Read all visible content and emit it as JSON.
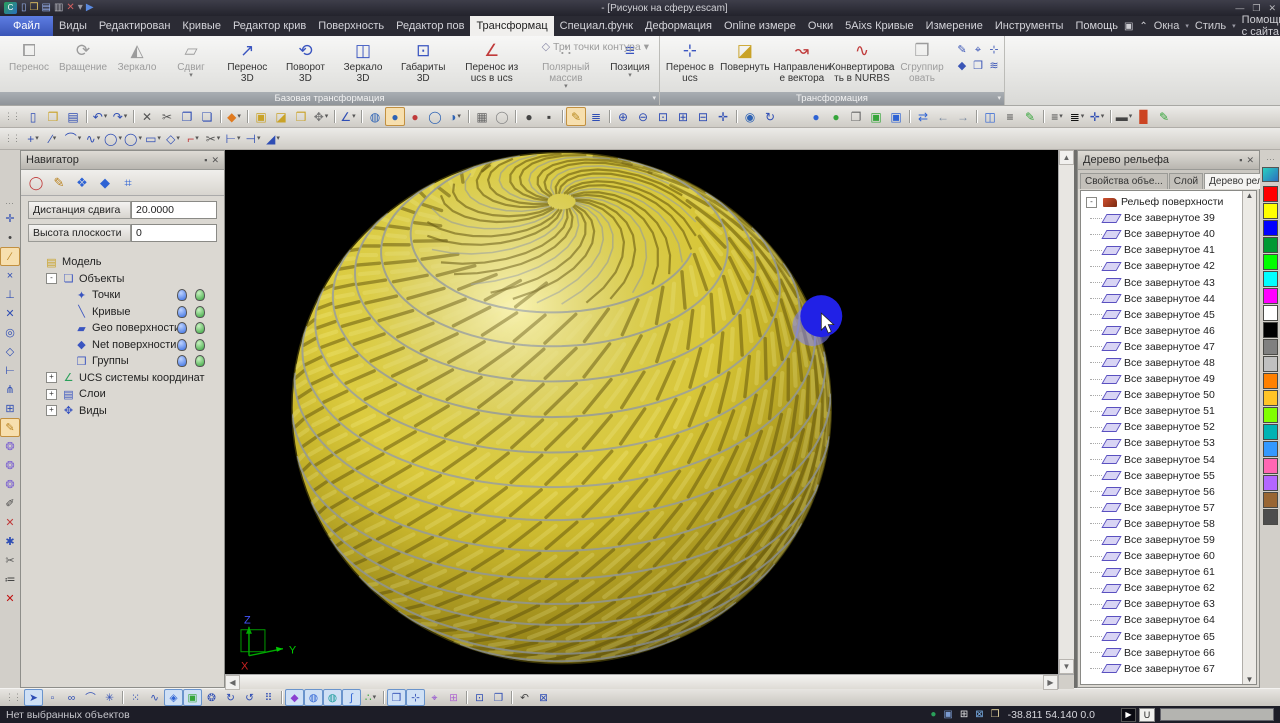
{
  "titlebar": {
    "title": "- [Рисунок на сферу.escam]",
    "logo_glyph": "C",
    "quick_icons": [
      {
        "name": "new-file-icon",
        "g": "▯",
        "c": "#9ab4f0"
      },
      {
        "name": "open-file-icon",
        "g": "❒",
        "c": "#e0c060"
      },
      {
        "name": "save-file-icon",
        "g": "▤",
        "c": "#9ab4f0"
      },
      {
        "name": "print-icon",
        "g": "▥",
        "c": "#b8b8c0"
      },
      {
        "name": "delete-icon",
        "g": "✕",
        "c": "#d06060"
      },
      {
        "name": "caret-icon",
        "g": "▾",
        "c": "#9a9aa4"
      },
      {
        "name": "play-icon",
        "g": "▶",
        "c": "#5a8ae0"
      }
    ],
    "controls": {
      "minimize": "—",
      "restore": "❐",
      "close": "✕"
    }
  },
  "menubar": {
    "items": [
      {
        "label": "Файл",
        "style": "file"
      },
      {
        "label": "Виды"
      },
      {
        "label": "Редактирован"
      },
      {
        "label": "Кривые"
      },
      {
        "label": "Редактор крив"
      },
      {
        "label": "Поверхность"
      },
      {
        "label": "Редактор пов"
      },
      {
        "label": "Трансформац",
        "style": "active"
      },
      {
        "label": "Специал.функ"
      },
      {
        "label": "Деформация"
      },
      {
        "label": "Online измере"
      },
      {
        "label": "Очки"
      },
      {
        "label": "5Aixs Кривые"
      },
      {
        "label": "Измерение"
      },
      {
        "label": "Инструменты"
      },
      {
        "label": "Помощь"
      }
    ],
    "right": {
      "window_label": "Окна",
      "style_label": "Стиль",
      "help_label": "Помощь с сайта"
    },
    "right_controls": {
      "minimize": "—",
      "restore": "❐",
      "close": "✕"
    }
  },
  "ribbon": {
    "group1": {
      "title": "Базовая трансформация",
      "buttons": [
        {
          "name": "move-button",
          "label": "Перенос",
          "g": "⧠",
          "c": "#9c9c9c",
          "dis": true
        },
        {
          "name": "rotate-button",
          "label": "Вращение",
          "g": "⟳",
          "c": "#9c9c9c",
          "dis": true
        },
        {
          "name": "mirror-button",
          "label": "Зеркало",
          "g": "◭",
          "c": "#9c9c9c",
          "dis": true
        },
        {
          "name": "shear-button",
          "label": "Сдвиг",
          "g": "▱",
          "c": "#9c9c9c",
          "dis": true,
          "dd": true
        },
        {
          "name": "move-3d-button",
          "label": "Перенос 3D",
          "g": "↗",
          "c": "#3a55c0"
        },
        {
          "name": "rotate-3d-button",
          "label": "Поворот 3D",
          "g": "⟲",
          "c": "#3a55c0"
        },
        {
          "name": "mirror-3d-button",
          "label": "Зеркало 3D",
          "g": "◫",
          "c": "#3a55c0"
        },
        {
          "name": "extents-3d-button",
          "label": "Габариты 3D",
          "g": "⊡",
          "c": "#3a55c0"
        },
        {
          "name": "move-ucs-to-ucs-button",
          "label": "Перенос из ucs в ucs",
          "g": "∠",
          "c": "#c03a3a"
        },
        {
          "name": "polar-array-button",
          "label": "Полярный массив",
          "g": "∴",
          "c": "#9c9c9c",
          "dis": true,
          "dd": true
        },
        {
          "name": "position-button",
          "label": "Позиция",
          "g": "≡",
          "c": "#3a55c0",
          "dd": true
        }
      ],
      "extra": {
        "label": "Три точки контура",
        "glyph": "◇"
      }
    },
    "group2": {
      "title": "Трансформация",
      "buttons": [
        {
          "name": "move-in-ucs-button",
          "label": "Перенос в ucs",
          "g": "⊹",
          "c": "#3a55c0"
        },
        {
          "name": "turn-button",
          "label": "Повернуть",
          "g": "◪",
          "c": "#c9a227"
        },
        {
          "name": "vector-direction-button",
          "label": "Направлени е вектора",
          "g": "↝",
          "c": "#c03a3a"
        },
        {
          "name": "convert-nurbs-button",
          "label": "Конвертирова ть в NURBS",
          "g": "∿",
          "c": "#c03a3a"
        },
        {
          "name": "group-button",
          "label": "Сгруппир овать",
          "g": "❒",
          "c": "#9c9c9c",
          "dis": true
        }
      ],
      "mini": [
        {
          "name": "mini-edit-icon",
          "g": "✎"
        },
        {
          "name": "mini-axes-icon",
          "g": "⌖"
        },
        {
          "name": "mini-pin-icon",
          "g": "⊹"
        },
        {
          "name": "mini-diamond-icon",
          "g": "◆"
        },
        {
          "name": "mini-copy-icon",
          "g": "❐"
        },
        {
          "name": "mini-layers-icon",
          "g": "≋"
        }
      ]
    }
  },
  "toolbar1": {
    "icons": [
      {
        "n": "new-file",
        "g": "▯",
        "c": "#2e4db4"
      },
      {
        "n": "open-file",
        "g": "❒",
        "c": "#c9a227"
      },
      {
        "n": "save-file",
        "g": "▤",
        "c": "#2e4db4"
      },
      "|",
      {
        "n": "undo",
        "g": "↶",
        "c": "#2e4db4",
        "dd": 1
      },
      {
        "n": "redo",
        "g": "↷",
        "c": "#2e4db4",
        "dd": 1
      },
      "|",
      {
        "n": "delete",
        "g": "✕",
        "c": "#555555"
      },
      {
        "n": "cut",
        "g": "✂",
        "c": "#555555"
      },
      {
        "n": "copy",
        "g": "❐",
        "c": "#2e4db4"
      },
      {
        "n": "paste",
        "g": "❏",
        "c": "#2e4db4"
      },
      "|",
      {
        "n": "view-iso",
        "g": "◆",
        "c": "#e07a1f",
        "dd": 1
      },
      "|",
      {
        "n": "view-cube-front",
        "g": "▣",
        "c": "#c9a227"
      },
      {
        "n": "view-cube-side",
        "g": "◪",
        "c": "#c9a227"
      },
      {
        "n": "view-cube-top",
        "g": "❒",
        "c": "#c9a227"
      },
      {
        "n": "view-more",
        "g": "✥",
        "c": "#777777",
        "dd": 1
      },
      "|",
      {
        "n": "view-ucs",
        "g": "∠",
        "c": "#2e4db4",
        "dd": 1
      },
      "|",
      {
        "n": "render-wireframe",
        "g": "◍",
        "c": "#2e63b4"
      },
      {
        "n": "render-shaded",
        "g": "●",
        "c": "#2e63b4",
        "sel": 1
      },
      {
        "n": "render-material",
        "g": "●",
        "c": "#c03a3a"
      },
      {
        "n": "render-ghost",
        "g": "◯",
        "c": "#2e63b4"
      },
      {
        "n": "render-half",
        "g": "◑",
        "c": "#2e63b4",
        "dd": 1
      },
      "|",
      {
        "n": "mesh-view",
        "g": "▦",
        "c": "#666666"
      },
      {
        "n": "sphere-plain",
        "g": "◯",
        "c": "#888888"
      },
      "|",
      {
        "n": "shade-dark",
        "g": "●",
        "c": "#444444"
      },
      {
        "n": "cube-dark",
        "g": "▪",
        "c": "#444444"
      },
      "|",
      {
        "n": "sketch-mode",
        "g": "✎",
        "c": "#b98a1f",
        "sel": 1
      },
      {
        "n": "plane-list",
        "g": "≣",
        "c": "#2e4db4"
      },
      "|",
      {
        "n": "zoom-in",
        "g": "⊕",
        "c": "#2e4db4"
      },
      {
        "n": "zoom-out",
        "g": "⊖",
        "c": "#2e4db4"
      },
      {
        "n": "zoom-window",
        "g": "⊡",
        "c": "#2e4db4"
      },
      {
        "n": "zoom-fit",
        "g": "⊞",
        "c": "#2e4db4"
      },
      {
        "n": "zoom-prev",
        "g": "⊟",
        "c": "#2e4db4"
      },
      {
        "n": "pan",
        "g": "✛",
        "c": "#2e4db4"
      },
      "|",
      {
        "n": "orbit",
        "g": "◉",
        "c": "#2e63b4"
      },
      {
        "n": "spin",
        "g": "↻",
        "c": "#2e4db4"
      },
      "gap",
      {
        "n": "lamp-blue",
        "g": "●",
        "c": "#2e63d4"
      },
      {
        "n": "lamp-green",
        "g": "●",
        "c": "#35a53a"
      },
      {
        "n": "copy-props",
        "g": "❐",
        "c": "#666666"
      },
      {
        "n": "box-green",
        "g": "▣",
        "c": "#35a53a"
      },
      {
        "n": "box-blue",
        "g": "▣",
        "c": "#2e63d4"
      },
      "|",
      {
        "n": "swap",
        "g": "⇄",
        "c": "#2e63d4"
      },
      {
        "n": "arrow-back",
        "g": "←",
        "c": "#7a8aa0"
      },
      {
        "n": "arrow-forward",
        "g": "→",
        "c": "#7a8aa0"
      },
      "|",
      {
        "n": "cube-edit",
        "g": "◫",
        "c": "#2e63d4"
      },
      {
        "n": "hatch-lines",
        "g": "≡",
        "c": "#444444"
      },
      {
        "n": "picker-pen",
        "g": "✎",
        "c": "#35a53a"
      },
      "|",
      {
        "n": "line-style",
        "g": "≡",
        "c": "#444444",
        "dd": 1
      },
      {
        "n": "line-weight",
        "g": "≣",
        "c": "#111111",
        "dd": 1
      },
      {
        "n": "point-style",
        "g": "✛",
        "c": "#2e4db4",
        "dd": 1
      },
      "|",
      {
        "n": "color-bar",
        "g": "▬",
        "c": "#444444",
        "dd": 1
      },
      {
        "n": "color-swatch",
        "g": "▉",
        "c": "#cc4422"
      },
      {
        "n": "color-picker",
        "g": "✎",
        "c": "#35a53a"
      }
    ]
  },
  "toolbar2": {
    "icons": [
      {
        "n": "draw-point",
        "g": "+",
        "c": "#2e4db4",
        "dd": 1
      },
      {
        "n": "draw-line",
        "g": "∕",
        "c": "#2e4db4",
        "dd": 1
      },
      {
        "n": "draw-arc",
        "g": "⌒",
        "c": "#2e4db4",
        "dd": 1
      },
      {
        "n": "draw-spline",
        "g": "∿",
        "c": "#2e4db4",
        "dd": 1
      },
      {
        "n": "draw-circle",
        "g": "◯",
        "c": "#2e4db4",
        "dd": 1
      },
      {
        "n": "draw-ellipse",
        "g": "◯",
        "c": "#2e4db4",
        "dd": 1
      },
      {
        "n": "draw-rect",
        "g": "▭",
        "c": "#2e4db4",
        "dd": 1
      },
      {
        "n": "draw-polygon",
        "g": "◇",
        "c": "#2e4db4",
        "dd": 1
      },
      {
        "n": "draw-fillet",
        "g": "⌐",
        "c": "#c03a3a",
        "dd": 1
      },
      {
        "n": "trim",
        "g": "✂",
        "c": "#555555",
        "dd": 1
      },
      {
        "n": "extend",
        "g": "⊢",
        "c": "#2e4db4",
        "dd": 1
      },
      {
        "n": "offset",
        "g": "⊣",
        "c": "#2e4db4",
        "dd": 1
      },
      {
        "n": "chamfer",
        "g": "◢",
        "c": "#2e4db4",
        "dd": 1
      }
    ]
  },
  "lefttools": {
    "icons": [
      {
        "n": "snap-node",
        "g": "✛",
        "c": "#2e4db4"
      },
      {
        "n": "snap-point",
        "g": "•",
        "c": "#444444"
      },
      {
        "n": "line-tool",
        "g": "∕",
        "c": "#b9821f",
        "sel": 1
      },
      {
        "n": "snap-intersect",
        "g": "×",
        "c": "#2e4db4"
      },
      {
        "n": "snap-perp",
        "g": "⊥",
        "c": "#2e4db4"
      },
      {
        "n": "snap-cross",
        "g": "✕",
        "c": "#2e4db4"
      },
      {
        "n": "snap-center",
        "g": "◎",
        "c": "#2e4db4"
      },
      {
        "n": "snap-quadrant",
        "g": "◇",
        "c": "#2e4db4"
      },
      {
        "n": "snap-tangent",
        "g": "⊢",
        "c": "#2e4db4"
      },
      {
        "n": "snap-angle",
        "g": "⋔",
        "c": "#2e4db4"
      },
      {
        "n": "snap-grid",
        "g": "⊞",
        "c": "#2e4db4"
      },
      {
        "n": "sketch-pencil",
        "g": "✎",
        "c": "#b9821f",
        "sel": 1
      },
      {
        "n": "surface-tool-1",
        "g": "❂",
        "c": "#7a5fd0"
      },
      {
        "n": "surface-tool-2",
        "g": "❂",
        "c": "#7a5fd0"
      },
      {
        "n": "surface-tool-3",
        "g": "❂",
        "c": "#7a5fd0"
      },
      {
        "n": "erase-tool",
        "g": "✐",
        "c": "#444444"
      },
      {
        "n": "delete-red",
        "g": "✕",
        "c": "#c03a3a"
      },
      {
        "n": "util-tool",
        "g": "✱",
        "c": "#2e4db4"
      },
      {
        "n": "cut-tool",
        "g": "✂",
        "c": "#555555"
      },
      {
        "n": "list-tool",
        "g": "≔",
        "c": "#444444"
      },
      {
        "n": "close-red",
        "g": "✕",
        "c": "#c01010"
      }
    ]
  },
  "navigator": {
    "title": "Навигатор",
    "tools": [
      {
        "n": "nav-profile",
        "g": "◯",
        "c": "#c03a3a"
      },
      {
        "n": "nav-sketch",
        "g": "✎",
        "c": "#b9821f"
      },
      {
        "n": "nav-mesh",
        "g": "❖",
        "c": "#2e63d4"
      },
      {
        "n": "nav-surface",
        "g": "◆",
        "c": "#2e63d4"
      },
      {
        "n": "nav-tools",
        "g": "⌗",
        "c": "#2e63d4"
      }
    ],
    "fields": [
      {
        "label": "Дистанция сдвига",
        "value": "20.0000"
      },
      {
        "label": "Высота плоскости",
        "value": "0"
      }
    ],
    "tree": [
      {
        "label": "Модель",
        "level": 0,
        "icon": "▤",
        "ic": "#c9a227",
        "exp": ""
      },
      {
        "label": "Объекты",
        "level": 1,
        "icon": "❏",
        "ic": "#3a55c0",
        "exp": "-"
      },
      {
        "label": "Точки",
        "level": 2,
        "icon": "✦",
        "ic": "#3a55c0",
        "lamps": true
      },
      {
        "label": "Кривые",
        "level": 2,
        "icon": "╲",
        "ic": "#3a55c0",
        "lamps": true
      },
      {
        "label": "Geo поверхности",
        "level": 2,
        "icon": "▰",
        "ic": "#3a55c0",
        "lamps": true
      },
      {
        "label": "Net поверхности",
        "level": 2,
        "icon": "◆",
        "ic": "#3a55c0",
        "lamps": true
      },
      {
        "label": "Группы",
        "level": 2,
        "icon": "❒",
        "ic": "#3a55c0",
        "lamps": true
      },
      {
        "label": "UCS системы координат",
        "level": 1,
        "icon": "∠",
        "ic": "#2aa05a",
        "exp": "+"
      },
      {
        "label": "Слои",
        "level": 1,
        "icon": "▤",
        "ic": "#3a55c0",
        "exp": "+"
      },
      {
        "label": "Виды",
        "level": 1,
        "icon": "✥",
        "ic": "#3a55c0",
        "exp": "+"
      }
    ]
  },
  "relief": {
    "title": "Дерево рельефа",
    "tabs": [
      "Свойства объе...",
      "Слой",
      "Дерево рельефа"
    ],
    "active_tab": 2,
    "root": "Рельеф поверхности",
    "items": [
      "Все завернутое 39",
      "Все завернутое 40",
      "Все завернутое 41",
      "Все завернутое 42",
      "Все завернутое 43",
      "Все завернутое 44",
      "Все завернутое 45",
      "Все завернутое 46",
      "Все завернутое 47",
      "Все завернутое 48",
      "Все завернутое 49",
      "Все завернутое 50",
      "Все завернутое 51",
      "Все завернутое 52",
      "Все завернутое 53",
      "Все завернутое 54",
      "Все завернутое 55",
      "Все завернутое 56",
      "Все завернутое 57",
      "Все завернутое 58",
      "Все завернутое 59",
      "Все завернутое 60",
      "Все завернутое 61",
      "Все завернутое 62",
      "Все завернутое 63",
      "Все завернутое 64",
      "Все завернутое 65",
      "Все завернутое 66",
      "Все завернутое 67"
    ]
  },
  "palette": {
    "colors": [
      "#ff0000",
      "#ffff00",
      "#0000ff",
      "#009933",
      "#00ff00",
      "#00ffff",
      "#ff00ff",
      "#ffffff",
      "#000000",
      "#808080",
      "#c0c0c0",
      "#ff8000",
      "#ffc426",
      "#80ff00",
      "#00b3b3",
      "#3399ff",
      "#ff66b3",
      "#b366ff",
      "#996633",
      "#4d4d4d"
    ]
  },
  "viewport": {
    "axis": {
      "x": "X",
      "y": "Y",
      "z": "Z",
      "x_color": "#cc2222",
      "y_color": "#00cc00",
      "z_color": "#4455ff",
      "line_color": "#00aa00"
    },
    "sphere": {
      "gold_light": "#f8f0a2",
      "gold_mid": "#d9ca32",
      "gold_dark": "#a8941c",
      "gold_rim": "#4c400a",
      "band_line": "#9aa0a0",
      "groove": "#6b5c0d",
      "sheen": "#f7ef8e"
    },
    "marker_color": "#2121e6",
    "marker_soft": "#7d7df5"
  },
  "bottombar": {
    "icons": [
      {
        "n": "pick-arrow",
        "g": "➤",
        "c": "#2e4db4",
        "sel": 1
      },
      {
        "n": "pick-rect",
        "g": "▫",
        "c": "#2e4db4"
      },
      {
        "n": "pick-chain",
        "g": "∞",
        "c": "#2e4db4"
      },
      {
        "n": "pick-curve",
        "g": "⌒",
        "c": "#2e4db4"
      },
      {
        "n": "pick-star",
        "g": "✳",
        "c": "#2e4db4"
      },
      "|",
      {
        "n": "snap-pts",
        "g": "⁙",
        "c": "#2e4db4"
      },
      {
        "n": "snap-spline",
        "g": "∿",
        "c": "#2e4db4"
      },
      {
        "n": "snap-diamond",
        "g": "◈",
        "c": "#2e63d4",
        "sel": 1
      },
      {
        "n": "snap-box-green",
        "g": "▣",
        "c": "#35a53a",
        "sel": 1
      },
      {
        "n": "snap-rotate",
        "g": "❂",
        "c": "#2e4db4"
      },
      {
        "n": "snap-cw",
        "g": "↻",
        "c": "#2e4db4"
      },
      {
        "n": "snap-ccw",
        "g": "↺",
        "c": "#2e4db4"
      },
      {
        "n": "snap-matrix",
        "g": "⠿",
        "c": "#2e4db4"
      },
      "|",
      {
        "n": "gem-purple",
        "g": "◆",
        "c": "#8a3fd0",
        "sel": 1
      },
      {
        "n": "ring-blue",
        "g": "◍",
        "c": "#2e63d4",
        "sel": 1
      },
      {
        "n": "ring-teal",
        "g": "◍",
        "c": "#189a9a",
        "sel": 1
      },
      {
        "n": "s-curve",
        "g": "∫",
        "c": "#2e63d4",
        "sel": 1
      },
      {
        "n": "axis-mode",
        "g": "∴",
        "c": "#35a53a",
        "dd": 1
      },
      "|",
      {
        "n": "win-tool",
        "g": "❒",
        "c": "#2e4db4",
        "sel": 1
      },
      {
        "n": "axis-tool",
        "g": "⊹",
        "c": "#2e4db4",
        "sel": 1
      },
      {
        "n": "target-tool",
        "g": "⌖",
        "c": "#8a3fd0"
      },
      {
        "n": "grid-tool",
        "g": "⊞",
        "c": "#b06ad0"
      },
      "|",
      {
        "n": "fit-tool",
        "g": "⊡",
        "c": "#2e4db4"
      },
      {
        "n": "window-tool",
        "g": "❐",
        "c": "#2e4db4"
      },
      "|",
      {
        "n": "undo-small",
        "g": "↶",
        "c": "#444444"
      },
      {
        "n": "close-small",
        "g": "⊠",
        "c": "#2e4db4"
      }
    ]
  },
  "statusbar": {
    "message": "Нет выбранных объектов",
    "icons": [
      {
        "n": "status-globe",
        "g": "●",
        "c": "#2aa05a"
      },
      {
        "n": "status-monitor",
        "g": "▣",
        "c": "#7a9ad0"
      },
      {
        "n": "status-grid",
        "g": "⊞",
        "c": "#e8e8e8"
      },
      {
        "n": "status-xwindow",
        "g": "⊠",
        "c": "#7ab0e8"
      },
      {
        "n": "status-folder",
        "g": "❒",
        "c": "#e8d8a0"
      }
    ],
    "coords": "-38.811 54.140 0.0",
    "play_glyph": "▶",
    "u_label": "U"
  }
}
